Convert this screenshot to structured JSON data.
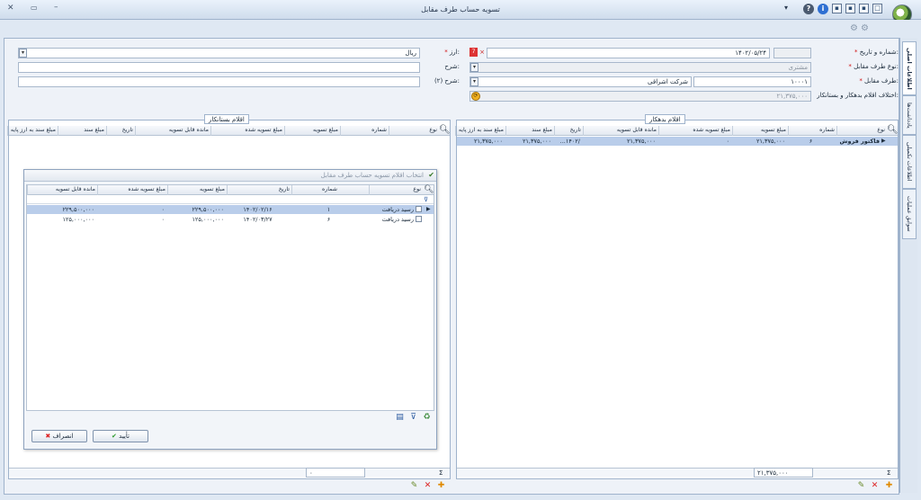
{
  "window": {
    "title": "تسویه حساب طرف مقابل"
  },
  "colors": {
    "accent": "#2e6fd2",
    "selected_row": "#b9cdea",
    "required": "#d01010"
  },
  "tabs": [
    {
      "label": "اطلاعات اصلی",
      "active": true
    },
    {
      "label": "یادداشت‌ها",
      "active": false
    },
    {
      "label": "اطلاعات تکمیلی",
      "active": false
    },
    {
      "label": "سوابق عملیات",
      "active": false
    }
  ],
  "header": {
    "number_date_label": "شماره و تاریخ:",
    "date_value": "۱۴۰۲/۰۵/۲۴",
    "number_value": "",
    "counterparty_type_label": "نوع طرف مقابل:",
    "counterparty_type_value": "مشتری",
    "counterparty_label": "طرف مقابل:",
    "counterparty_code": "۱۰۰۰۱",
    "counterparty_name": "شرکت اشراقی",
    "diff_label": "اختلاف اقلام بدهکار و بستانکار:",
    "diff_value": "۲۱,۳۷۵,۰۰۰",
    "currency_label": "ارز:",
    "currency_value": "ریال",
    "desc_label": "شرح:",
    "desc_value": "",
    "desc2_label": "شرح (۲):",
    "desc2_value": ""
  },
  "debit": {
    "title": "اقلام بدهکار",
    "columns": [
      "نوع",
      "شماره",
      "مبلغ تسویه",
      "مبلغ تسویه شده",
      "مانده قابل تسویه",
      "تاریخ",
      "مبلغ سند",
      "مبلغ سند به ارز پایه"
    ],
    "rows": [
      {
        "type": "فاکتور فروش",
        "number": "۶",
        "settle": "۲۱,۳۷۵,۰۰۰",
        "settled": "۰",
        "remaining": "۲۱,۳۷۵,۰۰۰",
        "date": "...۱۴۰۲/",
        "doc_amount": "۲۱,۳۷۵,۰۰۰",
        "doc_base": "۲۱,۳۷۵,۰۰۰"
      }
    ],
    "footer_total": "۲۱,۳۷۵,۰۰۰",
    "footer_sigma": "Σ"
  },
  "credit": {
    "title": "اقلام بستانکار",
    "columns": [
      "نوع",
      "شماره",
      "مبلغ تسویه",
      "مبلغ تسویه شده",
      "مانده قابل تسویه",
      "تاریخ",
      "مبلغ سند",
      "مبلغ سند به ارز پایه"
    ],
    "footer_total": "۰",
    "footer_sigma": "Σ"
  },
  "dialog": {
    "title": "انتخاب اقلام تسویه حساب طرف مقابل",
    "columns": [
      "نوع",
      "شماره",
      "تاریخ",
      "مبلغ تسویه",
      "مبلغ تسویه شده",
      "مانده قابل تسویه"
    ],
    "rows": [
      {
        "type": "رسید دریافت",
        "number": "۱",
        "date": "۱۴۰۲/۰۲/۱۶",
        "settle": "۲۲۹,۵۰۰,۰۰۰",
        "settled": "۰",
        "remaining": "۲۲۹,۵۰۰,۰۰۰"
      },
      {
        "type": "رسید دریافت",
        "number": "۶",
        "date": "۱۴۰۲/۰۳/۲۷",
        "settle": "۱۲۵,۰۰۰,۰۰۰",
        "settled": "۰",
        "remaining": "۱۲۵,۰۰۰,۰۰۰"
      }
    ],
    "ok_label": "تأیید",
    "cancel_label": "انصراف"
  }
}
